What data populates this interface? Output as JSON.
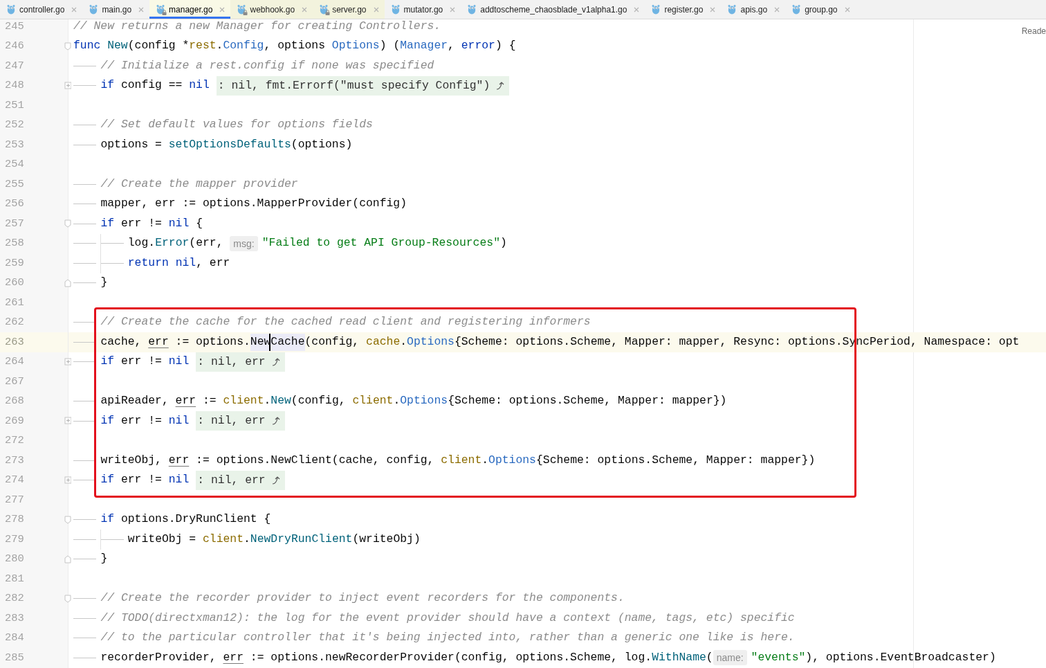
{
  "tabs": [
    {
      "label": "controller.go",
      "selected": false,
      "readonly": false
    },
    {
      "label": "main.go",
      "selected": false,
      "readonly": false
    },
    {
      "label": "manager.go",
      "selected": true,
      "readonly": true
    },
    {
      "label": "webhook.go",
      "selected": false,
      "readonly": true
    },
    {
      "label": "server.go",
      "selected": false,
      "readonly": true
    },
    {
      "label": "mutator.go",
      "selected": false,
      "readonly": false
    },
    {
      "label": "addtoscheme_chaosblade_v1alpha1.go",
      "selected": false,
      "readonly": false
    },
    {
      "label": "register.go",
      "selected": false,
      "readonly": false
    },
    {
      "label": "apis.go",
      "selected": false,
      "readonly": false
    },
    {
      "label": "group.go",
      "selected": false,
      "readonly": false
    }
  ],
  "reader_mode_label": "Reade",
  "editor": {
    "lines": [
      {
        "number": "245",
        "current": false,
        "boxed": false,
        "tokens": [
          {
            "text": "// New returns a new Manager for creating Controllers.",
            "kind": "comment"
          }
        ]
      },
      {
        "number": "246",
        "current": false,
        "boxed": false,
        "fold_marker": {
          "kind": "start",
          "collapsed": false
        },
        "tokens": [
          {
            "text": "func",
            "kind": "keyword"
          },
          {
            "text": "New",
            "kind": "func",
            "space_before": true
          },
          {
            "text": "(config *",
            "kind": "plain"
          },
          {
            "text": "rest",
            "kind": "pkg"
          },
          {
            "text": ".",
            "kind": "plain"
          },
          {
            "text": "Config",
            "kind": "type"
          },
          {
            "text": ", options ",
            "kind": "plain"
          },
          {
            "text": "Options",
            "kind": "type"
          },
          {
            "text": ") (",
            "kind": "plain"
          },
          {
            "text": "Manager",
            "kind": "type"
          },
          {
            "text": ", ",
            "kind": "plain"
          },
          {
            "text": "error",
            "kind": "keyword"
          },
          {
            "text": ") {",
            "kind": "plain"
          }
        ],
        "children": [
          {
            "number": "247",
            "current": false,
            "boxed": false,
            "tokens": [
              {
                "text": "// Initialize a rest.config if none was specified",
                "kind": "comment"
              }
            ]
          },
          {
            "number": "248",
            "current": false,
            "boxed": false,
            "fold_marker": {
              "kind": "start",
              "collapsed": true
            },
            "tokens": [
              {
                "text": "if",
                "kind": "keyword"
              },
              {
                "text": " config == ",
                "kind": "plain"
              },
              {
                "text": "nil",
                "kind": "keyword"
              },
              {
                "text": ": nil, fmt.Errorf(\"must specify Config\")",
                "kind": "fold"
              }
            ]
          },
          {
            "number": "251",
            "current": false,
            "boxed": false
          },
          {
            "number": "252",
            "current": false,
            "boxed": false,
            "tokens": [
              {
                "text": "// Set default values for options fields",
                "kind": "comment"
              }
            ]
          },
          {
            "number": "253",
            "current": false,
            "boxed": false,
            "tokens": [
              {
                "text": "options = ",
                "kind": "plain"
              },
              {
                "text": "setOptionsDefaults",
                "kind": "func"
              },
              {
                "text": "(options)",
                "kind": "plain"
              }
            ]
          },
          {
            "number": "254",
            "current": false,
            "boxed": false
          },
          {
            "number": "255",
            "current": false,
            "boxed": false,
            "tokens": [
              {
                "text": "// Create the mapper provider",
                "kind": "comment"
              }
            ]
          },
          {
            "number": "256",
            "current": false,
            "boxed": false,
            "tokens": [
              {
                "text": "mapper, err := options.MapperProvider(config)",
                "kind": "plain"
              }
            ]
          },
          {
            "number": "257",
            "current": false,
            "boxed": false,
            "fold_marker": {
              "kind": "start",
              "collapsed": false
            },
            "tokens": [
              {
                "text": "if",
                "kind": "keyword"
              },
              {
                "text": " err != ",
                "kind": "plain"
              },
              {
                "text": "nil",
                "kind": "keyword"
              },
              {
                "text": " {",
                "kind": "plain"
              }
            ],
            "children": [
              {
                "number": "258",
                "current": false,
                "boxed": false,
                "tokens": [
                  {
                    "text": "log.",
                    "kind": "plain"
                  },
                  {
                    "text": "Error",
                    "kind": "func"
                  },
                  {
                    "text": "(err, ",
                    "kind": "plain"
                  },
                  {
                    "text": "msg:",
                    "kind": "hint"
                  },
                  {
                    "text": "\"Failed to get API Group-Resources\"",
                    "kind": "string"
                  },
                  {
                    "text": ")",
                    "kind": "plain"
                  }
                ]
              },
              {
                "number": "259",
                "current": false,
                "boxed": false,
                "tokens": [
                  {
                    "text": "return",
                    "kind": "keyword"
                  },
                  {
                    "text": "nil",
                    "kind": "keyword",
                    "space_before": true
                  },
                  {
                    "text": ", err",
                    "kind": "plain"
                  }
                ]
              }
            ]
          },
          {
            "number": "260",
            "current": false,
            "boxed": false,
            "fold_marker": {
              "kind": "end",
              "collapsed": false
            },
            "tokens": [
              {
                "text": "}",
                "kind": "plain"
              }
            ]
          },
          {
            "number": "261",
            "current": false,
            "boxed": false
          },
          {
            "number": "262",
            "current": false,
            "boxed": true,
            "tokens": [
              {
                "text": "// Create the cache for the cached read client and registering informers",
                "kind": "comment"
              }
            ]
          },
          {
            "number": "263",
            "current": true,
            "boxed": true,
            "tokens": [
              {
                "text": "cache, ",
                "kind": "plain"
              },
              {
                "text": "err",
                "kind": "underline"
              },
              {
                "text": " := options.",
                "kind": "plain"
              },
              {
                "text": "New",
                "kind": "highlight"
              },
              {
                "text": "Cache",
                "kind": "highlight",
                "caret_before": true
              },
              {
                "text": "(config, ",
                "kind": "plain"
              },
              {
                "text": "cache",
                "kind": "pkg"
              },
              {
                "text": ".",
                "kind": "plain"
              },
              {
                "text": "Options",
                "kind": "type"
              },
              {
                "text": "{Scheme: options.Scheme, Mapper: mapper, Resync: options.SyncPeriod, Namespace: opt",
                "kind": "plain"
              }
            ]
          },
          {
            "number": "264",
            "current": false,
            "boxed": true,
            "fold_marker": {
              "kind": "start",
              "collapsed": true
            },
            "tokens": [
              {
                "text": "if",
                "kind": "keyword"
              },
              {
                "text": " err != ",
                "kind": "plain"
              },
              {
                "text": "nil",
                "kind": "keyword"
              },
              {
                "text": ": nil, err",
                "kind": "fold"
              }
            ]
          },
          {
            "number": "267",
            "current": false,
            "boxed": true
          },
          {
            "number": "268",
            "current": false,
            "boxed": true,
            "tokens": [
              {
                "text": "apiReader, ",
                "kind": "plain"
              },
              {
                "text": "err",
                "kind": "underline"
              },
              {
                "text": " := ",
                "kind": "plain"
              },
              {
                "text": "client",
                "kind": "pkg"
              },
              {
                "text": ".",
                "kind": "plain"
              },
              {
                "text": "New",
                "kind": "func"
              },
              {
                "text": "(config, ",
                "kind": "plain"
              },
              {
                "text": "client",
                "kind": "pkg"
              },
              {
                "text": ".",
                "kind": "plain"
              },
              {
                "text": "Options",
                "kind": "type"
              },
              {
                "text": "{Scheme: options.Scheme, Mapper: mapper})",
                "kind": "plain"
              }
            ]
          },
          {
            "number": "269",
            "current": false,
            "boxed": true,
            "fold_marker": {
              "kind": "start",
              "collapsed": true
            },
            "tokens": [
              {
                "text": "if",
                "kind": "keyword"
              },
              {
                "text": " err != ",
                "kind": "plain"
              },
              {
                "text": "nil",
                "kind": "keyword"
              },
              {
                "text": ": nil, err",
                "kind": "fold"
              }
            ]
          },
          {
            "number": "272",
            "current": false,
            "boxed": true
          },
          {
            "number": "273",
            "current": false,
            "boxed": true,
            "tokens": [
              {
                "text": "writeObj, ",
                "kind": "plain"
              },
              {
                "text": "err",
                "kind": "underline"
              },
              {
                "text": " := options.NewClient(cache, config, ",
                "kind": "plain"
              },
              {
                "text": "client",
                "kind": "pkg"
              },
              {
                "text": ".",
                "kind": "plain"
              },
              {
                "text": "Options",
                "kind": "type"
              },
              {
                "text": "{Scheme: options.Scheme, Mapper: mapper})",
                "kind": "plain"
              }
            ]
          },
          {
            "number": "274",
            "current": false,
            "boxed": true,
            "fold_marker": {
              "kind": "start",
              "collapsed": true
            },
            "tokens": [
              {
                "text": "if",
                "kind": "keyword"
              },
              {
                "text": " err != ",
                "kind": "plain"
              },
              {
                "text": "nil",
                "kind": "keyword"
              },
              {
                "text": ": nil, err",
                "kind": "fold"
              }
            ]
          },
          {
            "number": "277",
            "current": false,
            "boxed": false
          },
          {
            "number": "278",
            "current": false,
            "boxed": false,
            "fold_marker": {
              "kind": "start",
              "collapsed": false
            },
            "tokens": [
              {
                "text": "if",
                "kind": "keyword"
              },
              {
                "text": " options.DryRunClient {",
                "kind": "plain"
              }
            ],
            "children": [
              {
                "number": "279",
                "current": false,
                "boxed": false,
                "tokens": [
                  {
                    "text": "writeObj = ",
                    "kind": "plain"
                  },
                  {
                    "text": "client",
                    "kind": "pkg"
                  },
                  {
                    "text": ".",
                    "kind": "plain"
                  },
                  {
                    "text": "NewDryRunClient",
                    "kind": "func"
                  },
                  {
                    "text": "(writeObj)",
                    "kind": "plain"
                  }
                ]
              }
            ]
          },
          {
            "number": "280",
            "current": false,
            "boxed": false,
            "fold_marker": {
              "kind": "end",
              "collapsed": false
            },
            "tokens": [
              {
                "text": "}",
                "kind": "plain"
              }
            ]
          },
          {
            "number": "281",
            "current": false,
            "boxed": false
          },
          {
            "number": "282",
            "current": false,
            "boxed": false,
            "fold_marker": {
              "kind": "start",
              "collapsed": false
            },
            "tokens": [
              {
                "text": "// Create the recorder provider to inject event recorders for the components.",
                "kind": "comment"
              }
            ]
          },
          {
            "number": "283",
            "current": false,
            "boxed": false,
            "tokens": [
              {
                "text": "// TODO(directxman12): the log for the event provider should have a context (name, tags, etc) specific",
                "kind": "comment"
              }
            ]
          },
          {
            "number": "284",
            "current": false,
            "boxed": false,
            "tokens": [
              {
                "text": "// to the particular controller that it's being injected into, rather than a generic one like is here.",
                "kind": "comment"
              }
            ]
          },
          {
            "number": "285",
            "current": false,
            "boxed": false,
            "tokens": [
              {
                "text": "recorderProvider, ",
                "kind": "plain"
              },
              {
                "text": "err",
                "kind": "underline"
              },
              {
                "text": " := options.newRecorderProvider(config, options.Scheme, log.",
                "kind": "plain"
              },
              {
                "text": "WithName",
                "kind": "func"
              },
              {
                "text": "(",
                "kind": "plain"
              },
              {
                "text": "name:",
                "kind": "hint"
              },
              {
                "text": "\"events\"",
                "kind": "string"
              },
              {
                "text": "), options.EventBroadcaster)",
                "kind": "plain"
              }
            ]
          }
        ]
      }
    ]
  }
}
